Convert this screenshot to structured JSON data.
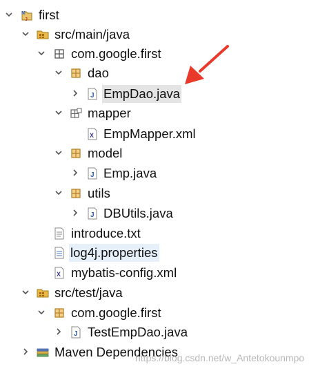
{
  "tree": {
    "items": [
      {
        "label": "first",
        "icon": "maven-project-icon",
        "toggle": "expanded"
      },
      {
        "label": "src/main/java",
        "icon": "source-folder-icon",
        "toggle": "expanded"
      },
      {
        "label": "com.google.first",
        "icon": "empty-package-icon",
        "toggle": "expanded"
      },
      {
        "label": "dao",
        "icon": "package-icon",
        "toggle": "expanded"
      },
      {
        "label": "EmpDao.java",
        "icon": "java-file-icon",
        "toggle": "collapsed"
      },
      {
        "label": "mapper",
        "icon": "folder-package-icon",
        "toggle": "expanded"
      },
      {
        "label": "EmpMapper.xml",
        "icon": "xml-file-icon",
        "toggle": "none"
      },
      {
        "label": "model",
        "icon": "package-icon",
        "toggle": "expanded"
      },
      {
        "label": "Emp.java",
        "icon": "java-file-icon",
        "toggle": "collapsed"
      },
      {
        "label": "utils",
        "icon": "package-icon",
        "toggle": "expanded"
      },
      {
        "label": "DBUtils.java",
        "icon": "java-file-icon",
        "toggle": "collapsed"
      },
      {
        "label": "introduce.txt",
        "icon": "text-file-icon",
        "toggle": "none"
      },
      {
        "label": "log4j.properties",
        "icon": "properties-file-icon",
        "toggle": "none"
      },
      {
        "label": "mybatis-config.xml",
        "icon": "xml-file-icon",
        "toggle": "none"
      },
      {
        "label": "src/test/java",
        "icon": "source-folder-icon",
        "toggle": "expanded"
      },
      {
        "label": "com.google.first",
        "icon": "package-icon",
        "toggle": "expanded"
      },
      {
        "label": "TestEmpDao.java",
        "icon": "java-file-icon",
        "toggle": "collapsed"
      },
      {
        "label": "Maven Dependencies",
        "icon": "library-icon",
        "toggle": "collapsed"
      }
    ]
  },
  "watermark": "https://blog.csdn.net/w_Antetokounmpo",
  "colors": {
    "arrow": "#e8392b",
    "package": "#b8842a",
    "java": "#2f5ea8",
    "selected_bg": "#e4e4e4",
    "hover_bg": "#e6f0fa"
  }
}
